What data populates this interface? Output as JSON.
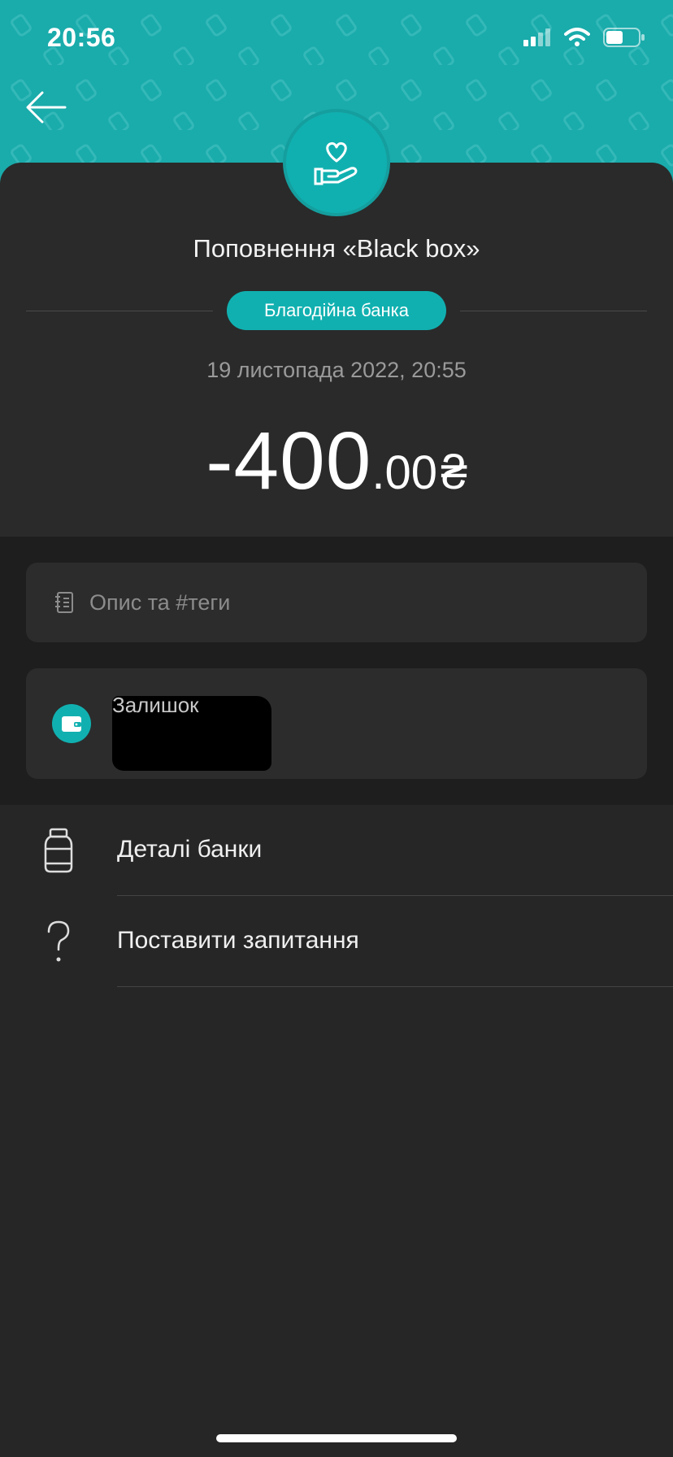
{
  "status_bar": {
    "time": "20:56"
  },
  "header": {
    "accent_color": "#1aabab",
    "back_icon": "arrow-left-icon"
  },
  "transaction": {
    "icon": "heart-hand-icon",
    "title": "Поповнення «Black box»",
    "category": "Благодійна банка",
    "datetime": "19 листопада 2022, 20:55",
    "amount_main": "-400",
    "amount_fraction": ".00",
    "currency": "₴"
  },
  "description": {
    "placeholder": "Опис та #теги",
    "icon": "notepad-icon"
  },
  "balance": {
    "label": "Залишок",
    "icon": "wallet-icon"
  },
  "menu": {
    "items": [
      {
        "label": "Деталі банки",
        "icon": "jar-icon"
      },
      {
        "label": "Поставити запитання",
        "icon": "question-icon"
      }
    ]
  }
}
